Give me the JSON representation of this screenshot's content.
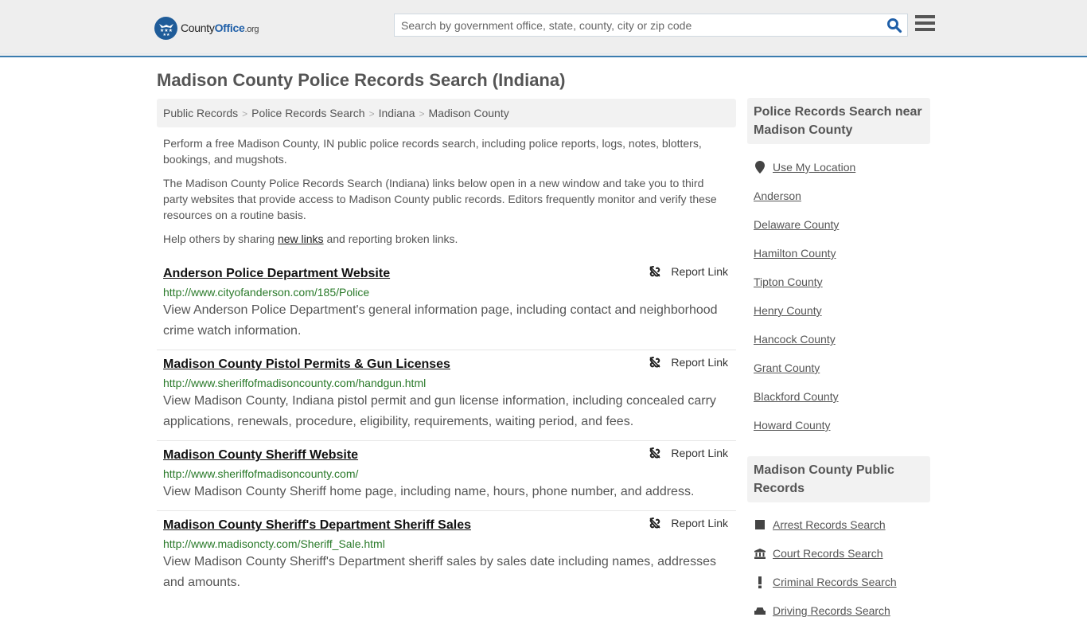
{
  "header": {
    "logo": {
      "county": "County",
      "office": "Office",
      "org": ".org"
    },
    "search_placeholder": "Search by government office, state, county, city or zip code"
  },
  "page_title": "Madison County Police Records Search (Indiana)",
  "breadcrumb": [
    "Public Records",
    "Police Records Search",
    "Indiana",
    "Madison County"
  ],
  "intro": {
    "p1": "Perform a free Madison County, IN public police records search, including police reports, logs, notes, blotters, bookings, and mugshots.",
    "p2": "The Madison County Police Records Search (Indiana) links below open in a new window and take you to third party websites that provide access to Madison County public records. Editors frequently monitor and verify these resources on a routine basis.",
    "p3_before": "Help others by sharing ",
    "p3_link": "new links",
    "p3_after": " and reporting broken links."
  },
  "report_label": "Report Link",
  "results": [
    {
      "title": "Anderson Police Department Website",
      "url": "http://www.cityofanderson.com/185/Police",
      "desc": "View Anderson Police Department's general information page, including contact and neighborhood crime watch information."
    },
    {
      "title": "Madison County Pistol Permits & Gun Licenses",
      "url": "http://www.sheriffofmadisoncounty.com/handgun.html",
      "desc": "View Madison County, Indiana pistol permit and gun license information, including concealed carry applications, renewals, procedure, eligibility, requirements, waiting period, and fees."
    },
    {
      "title": "Madison County Sheriff Website",
      "url": "http://www.sheriffofmadisoncounty.com/",
      "desc": "View Madison County Sheriff home page, including name, hours, phone number, and address."
    },
    {
      "title": "Madison County Sheriff's Department Sheriff Sales",
      "url": "http://www.madisoncty.com/Sheriff_Sale.html",
      "desc": "View Madison County Sheriff's Department sheriff sales by sales date including names, addresses and amounts."
    }
  ],
  "sidebar": {
    "nearby_title": "Police Records Search near Madison County",
    "use_location": "Use My Location",
    "nearby": [
      "Anderson",
      "Delaware County",
      "Hamilton County",
      "Tipton County",
      "Henry County",
      "Hancock County",
      "Grant County",
      "Blackford County",
      "Howard County"
    ],
    "public_title": "Madison County Public Records",
    "public": [
      {
        "icon": "square-icon",
        "label": "Arrest Records Search"
      },
      {
        "icon": "courthouse-icon",
        "label": "Court Records Search"
      },
      {
        "icon": "exclamation-icon",
        "label": "Criminal Records Search"
      },
      {
        "icon": "car-icon",
        "label": "Driving Records Search"
      }
    ]
  },
  "colors": {
    "accent": "#3a7caf",
    "url_green": "#2a7a2a",
    "logo_blue": "#1f5c99"
  }
}
